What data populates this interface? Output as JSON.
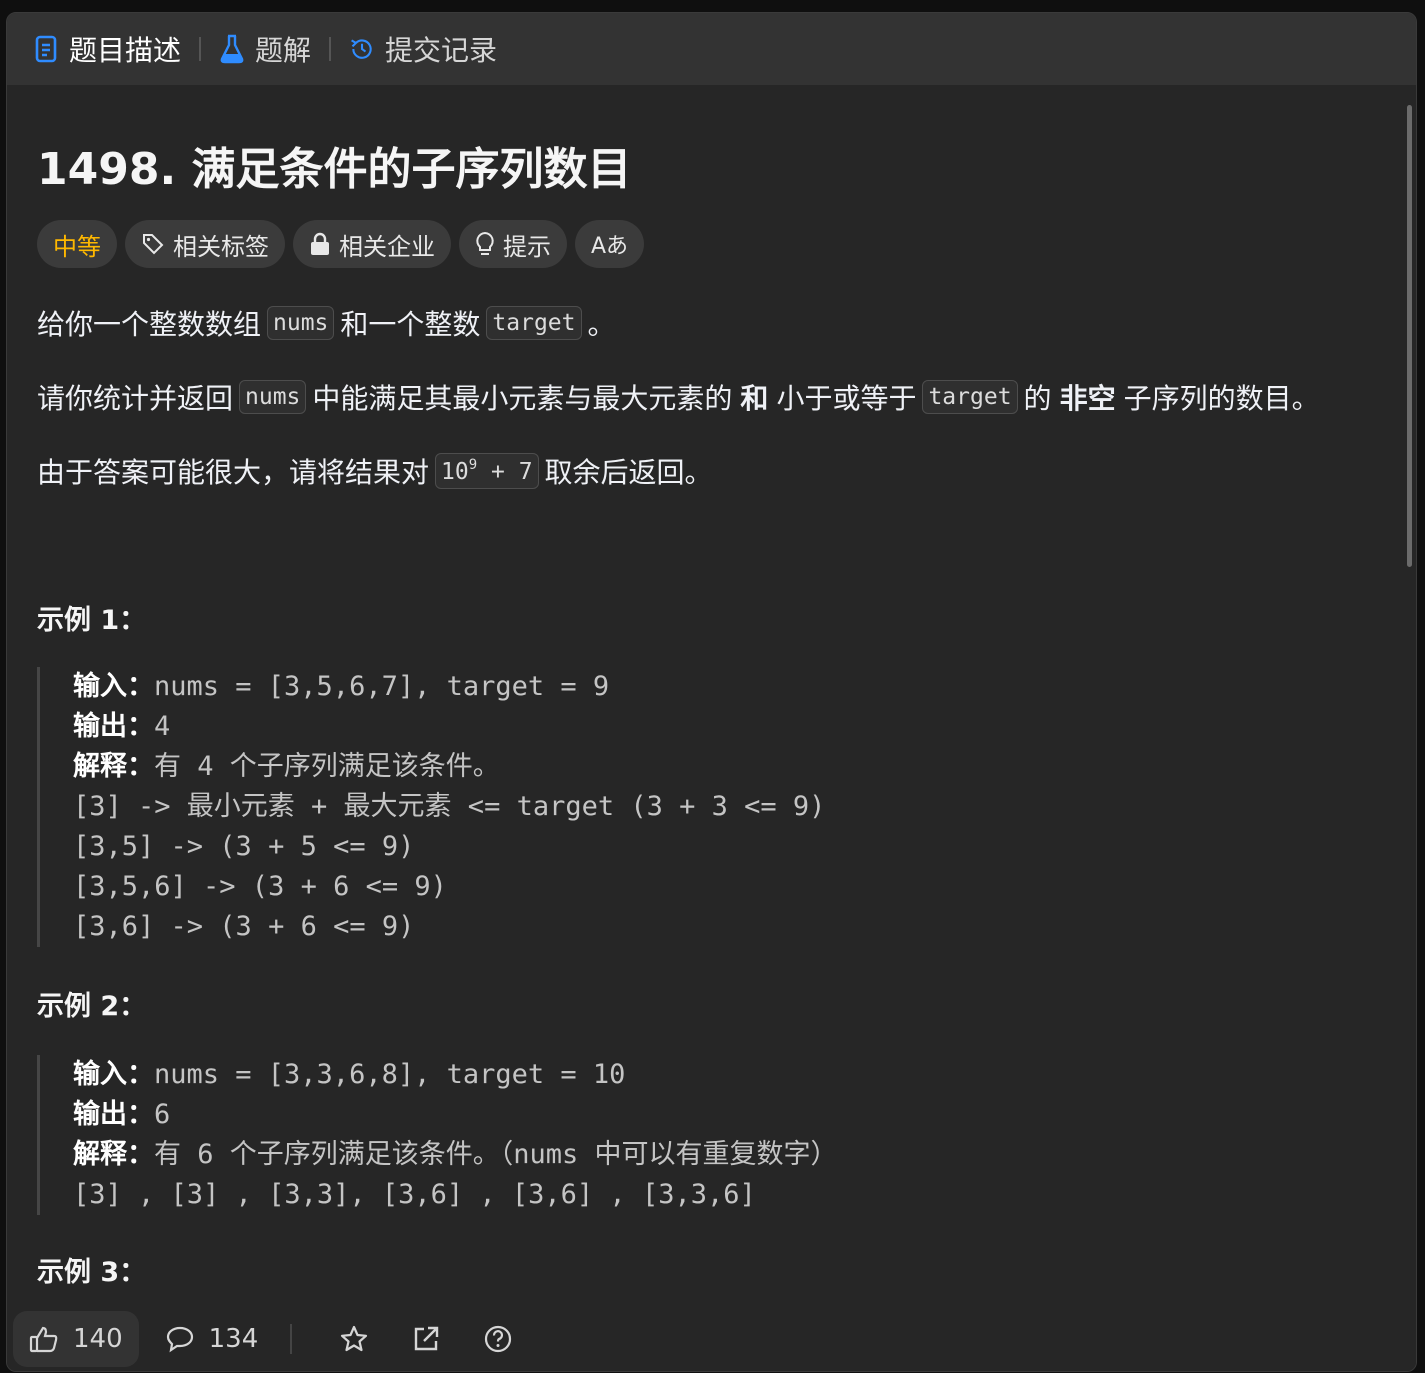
{
  "tabs": [
    {
      "label": "题目描述",
      "icon": "document-icon"
    },
    {
      "label": "题解",
      "icon": "flask-icon"
    },
    {
      "label": "提交记录",
      "icon": "history-icon"
    }
  ],
  "problem": {
    "title": "1498. 满足条件的子序列数目",
    "difficulty": "中等",
    "difficulty_color": "#ffb800",
    "chips": [
      "相关标签",
      "相关企业",
      "提示"
    ],
    "font_chip_label": "Aあ"
  },
  "description": {
    "p1": {
      "a": "给你一个整数数组",
      "code1": "nums",
      "b": "和一个整数",
      "code2": "target",
      "c": "。"
    },
    "p2": {
      "a": "请你统计并返回",
      "code1": "nums",
      "b": "中能满足其最小元素与最大元素的",
      "bold1": "和",
      "c": "小于或等于",
      "code2": "target",
      "d": "的",
      "bold2": "非空",
      "e": "子序列的数目。"
    },
    "p3": {
      "a": "由于答案可能很大，请将结果对",
      "code_base": "10",
      "code_exp": "9",
      "code_rest": " + 7",
      "b": "取余后返回。"
    }
  },
  "examples": [
    {
      "heading": "示例 1：",
      "input_label": "输入：",
      "input": "nums = [3,5,6,7], target = 9",
      "output_label": "输出：",
      "output": "4",
      "explain_label": "解释：",
      "explain": "有 4 个子序列满足该条件。",
      "lines": [
        "[3] -> 最小元素 + 最大元素 <= target (3 + 3 <= 9)",
        "[3,5] -> (3 + 5 <= 9)",
        "[3,5,6] -> (3 + 6 <= 9)",
        "[3,6] -> (3 + 6 <= 9)"
      ]
    },
    {
      "heading": "示例 2：",
      "input_label": "输入：",
      "input": "nums = [3,3,6,8], target = 10",
      "output_label": "输出：",
      "output": "6",
      "explain_label": "解释：",
      "explain": "有 6 个子序列满足该条件。（nums 中可以有重复数字）",
      "lines": [
        "[3] , [3] , [3,3], [3,6] , [3,6] , [3,3,6]"
      ]
    },
    {
      "heading": "示例 3："
    }
  ],
  "footer": {
    "likes": "140",
    "comments": "134"
  }
}
